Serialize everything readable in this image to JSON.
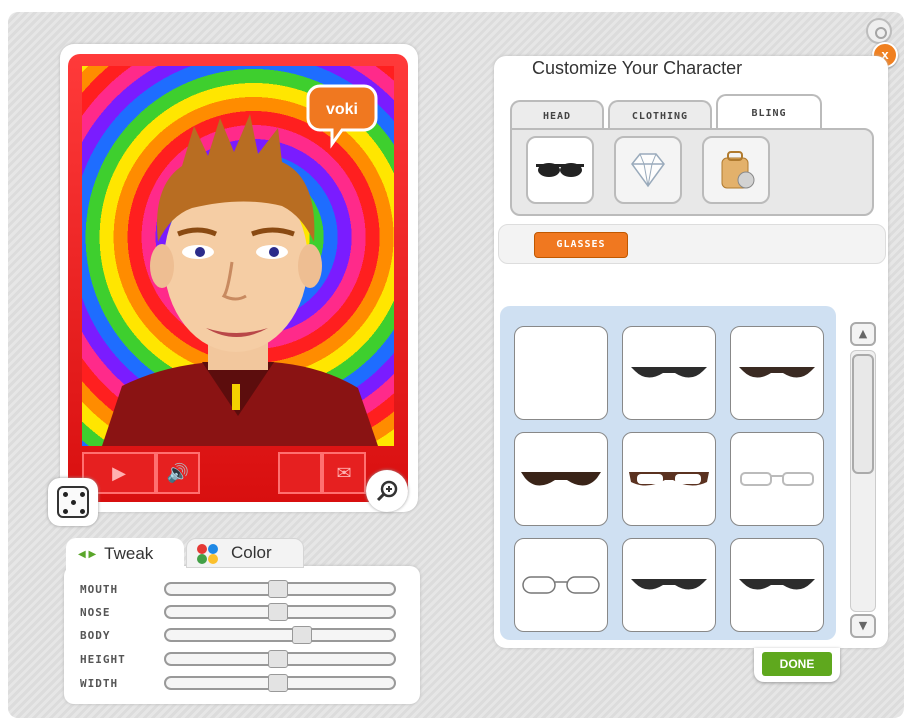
{
  "player": {
    "logo_text": "voki",
    "controls": [
      "play-icon",
      "volume-icon",
      "record-icon",
      "speech-icon"
    ]
  },
  "tweak": {
    "tabs": [
      {
        "label": "Tweak",
        "icon": "arrows-icon",
        "active": true
      },
      {
        "label": "Color",
        "icon": "palette-icon",
        "active": false
      }
    ],
    "sliders": [
      {
        "label": "MOUTH",
        "value": 0.5
      },
      {
        "label": "NOSE",
        "value": 0.5
      },
      {
        "label": "BODY",
        "value": 0.62
      },
      {
        "label": "HEIGHT",
        "value": 0.5
      },
      {
        "label": "WIDTH",
        "value": 0.5
      }
    ]
  },
  "customize": {
    "title": "Customize Your Character",
    "tabs": [
      {
        "label": "HEAD",
        "active": false
      },
      {
        "label": "CLOTHING",
        "active": false
      },
      {
        "label": "BLING",
        "active": true
      }
    ],
    "categories": [
      {
        "name": "sunglasses-icon",
        "active": true
      },
      {
        "name": "diamond-icon",
        "active": false
      },
      {
        "name": "backpack-icon",
        "active": false
      }
    ],
    "subcategory_button": "GLASSES",
    "items": [
      {
        "type": "none"
      },
      {
        "type": "dark-glasses"
      },
      {
        "type": "dark-glasses-brown"
      },
      {
        "type": "dark-glasses-thick"
      },
      {
        "type": "brown-frame-glasses"
      },
      {
        "type": "light-frame-glasses"
      },
      {
        "type": "outline-glasses"
      },
      {
        "type": "dark-glasses"
      },
      {
        "type": "dark-glasses"
      }
    ],
    "done_label": "DONE"
  },
  "colors": {
    "accent_orange": "#f07820",
    "done_green": "#5fa81e",
    "player_red": "#e02020"
  }
}
